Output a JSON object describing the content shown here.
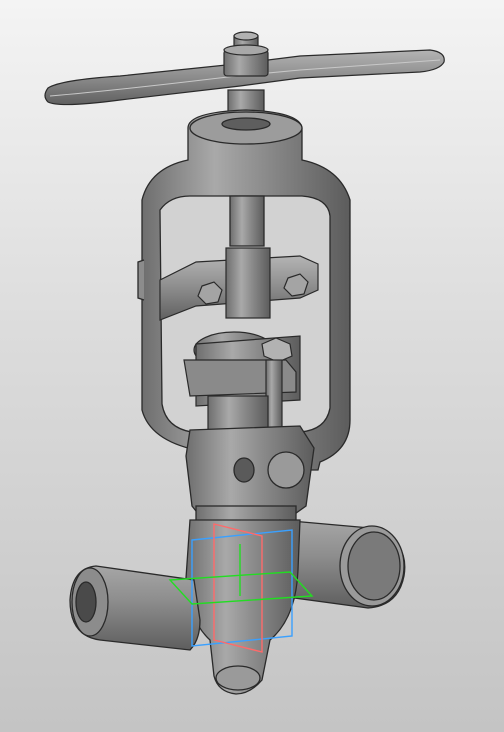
{
  "viewport": {
    "background_top": "#f4f4f4",
    "background_bottom": "#c4c4c4",
    "model_color": "#8e8e8e",
    "edge_color": "#2a2a2a"
  },
  "triad": {
    "frame_x_color": "#3aa0ff",
    "frame_y_color": "#ff6a6a",
    "plane_z_color": "#22dd22"
  }
}
